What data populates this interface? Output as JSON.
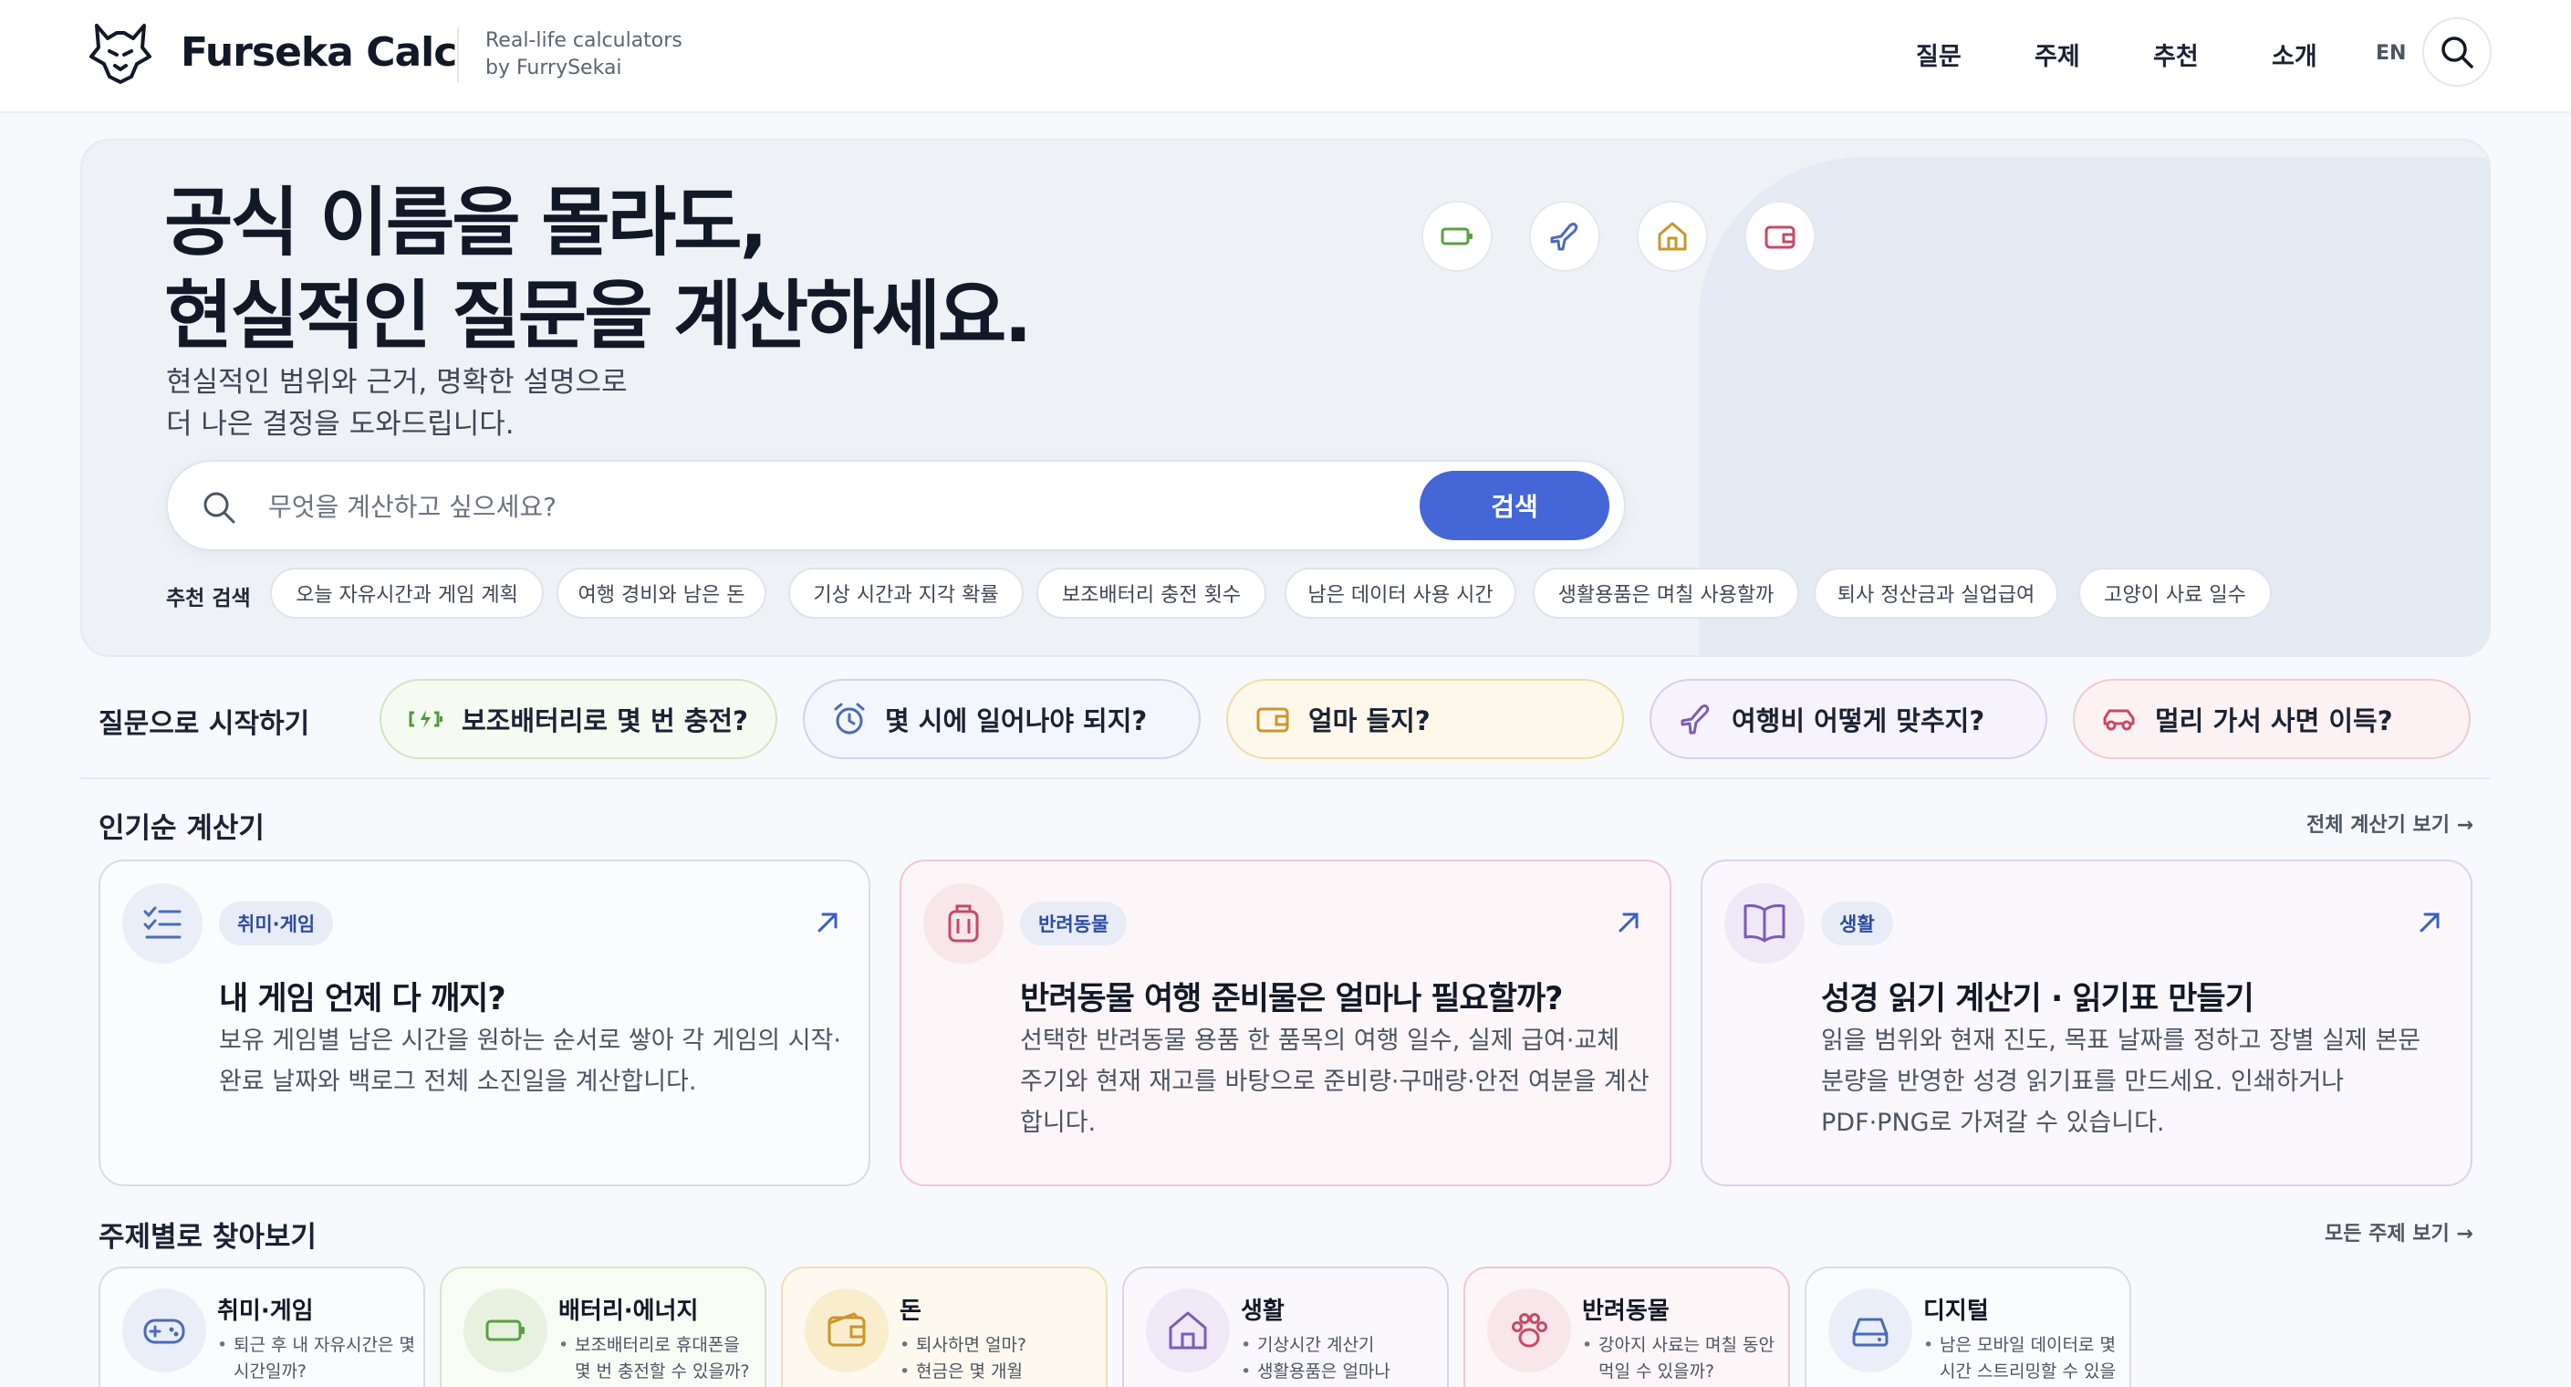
{
  "header": {
    "brand": "Furseka Calc",
    "tagline_line1": "Real-life calculators",
    "tagline_line2": "by FurrySekai",
    "nav": [
      "질문",
      "주제",
      "추천",
      "소개"
    ],
    "lang": "EN"
  },
  "hero": {
    "title_line1": "공식 이름을 몰라도,",
    "title_line2": "현실적인 질문을 계산하세요.",
    "sub_line1": "현실적인 범위와 근거, 명확한 설명으로",
    "sub_line2": "더 나은 결정을 도와드립니다.",
    "search_placeholder": "무엇을 계산하고 싶으세요?",
    "search_button": "검색",
    "recommended_label": "추천 검색",
    "chips": [
      "오늘 자유시간과 게임 계획",
      "여행 경비와 남은 돈",
      "기상 시간과 지각 확률",
      "보조배터리 충전 횟수",
      "남은 데이터 사용 시간",
      "생활용품은 며칠 사용할까",
      "퇴사 정산금과 실업급여",
      "고양이 사료 일수"
    ],
    "icons": [
      "battery-icon",
      "plane-icon",
      "home-icon",
      "wallet-icon"
    ]
  },
  "quick": {
    "label": "질문으로 시작하기",
    "items": [
      {
        "text": "보조배터리로 몇 번 충전?",
        "icon": "battery-charging-icon",
        "border": "#cfe5c4",
        "bg": "#f6fbf2",
        "color": "#4f9a3a"
      },
      {
        "text": "몇 시에 일어나야 되지?",
        "icon": "alarm-clock-icon",
        "border": "#c9d6ee",
        "bg": "#f3f6fc",
        "color": "#4a6bb8"
      },
      {
        "text": "얼마 들지?",
        "icon": "wallet-icon",
        "border": "#f0dca6",
        "bg": "#fdf8ea",
        "color": "#c9962a"
      },
      {
        "text": "여행비 어떻게 맞추지?",
        "icon": "plane-icon",
        "border": "#dccbed",
        "bg": "#f7f3fc",
        "color": "#7d5bb4"
      },
      {
        "text": "멀리 가서 사면 이득?",
        "icon": "car-icon",
        "border": "#f0c9d2",
        "bg": "#fcf2f4",
        "color": "#c74a64"
      }
    ]
  },
  "popular": {
    "title": "인기순 계산기",
    "link": "전체 계산기 보기 →",
    "cards": [
      {
        "tag": "취미·게임",
        "title": "내 게임 언제 다 깨지?",
        "desc": "보유 게임별 남은 시간을 원하는 순서로 쌓아 각 게임의 시작·완료 날짜와 백로그 전체 소진일을 계산합니다.",
        "icon": "checklist-icon"
      },
      {
        "tag": "반려동물",
        "title": "반려동물 여행 준비물은 얼마나 필요할까?",
        "desc": "선택한 반려동물 용품 한 품목의 여행 일수, 실제 급여·교체 주기와 현재 재고를 바탕으로 준비량·구매량·안전 여분을 계산합니다.",
        "icon": "luggage-icon"
      },
      {
        "tag": "생활",
        "title": "성경 읽기 계산기 · 읽기표 만들기",
        "desc": "읽을 범위와 현재 진도, 목표 날짜를 정하고 장별 실제 본문 분량을 반영한 성경 읽기표를 만드세요. 인쇄하거나 PDF·PNG로 가져갈 수 있습니다.",
        "icon": "book-icon"
      }
    ]
  },
  "topics": {
    "title": "주제별로 찾아보기",
    "link": "모든 주제 보기 →",
    "cards": [
      {
        "title": "취미·게임",
        "items": [
          "퇴근 후 내 자유시간은 몇 시간일까?"
        ],
        "icon": "gamepad-icon"
      },
      {
        "title": "배터리·에너지",
        "items": [
          "보조배터리로 휴대폰을 몇 번 충전할 수 있을까?"
        ],
        "icon": "battery-icon"
      },
      {
        "title": "돈",
        "items": [
          "퇴사하면 얼마?",
          "현금은 몇 개월"
        ],
        "icon": "wallet-icon"
      },
      {
        "title": "생활",
        "items": [
          "기상시간 계산기",
          "생활용품은 얼마나"
        ],
        "icon": "home-icon"
      },
      {
        "title": "반려동물",
        "items": [
          "강아지 사료는 며칠 동안 먹일 수 있을까?"
        ],
        "icon": "paw-icon"
      },
      {
        "title": "디지털",
        "items": [
          "남은 모바일 데이터로 몇 시간 스트리밍할 수 있을까?"
        ],
        "icon": "storage-icon"
      }
    ]
  },
  "colors": {
    "accent": "#4466d6",
    "green": "#5aa040",
    "blue": "#4a6bb8",
    "gold": "#c9962a",
    "purple": "#7d5bb4",
    "rose": "#c74a64"
  }
}
